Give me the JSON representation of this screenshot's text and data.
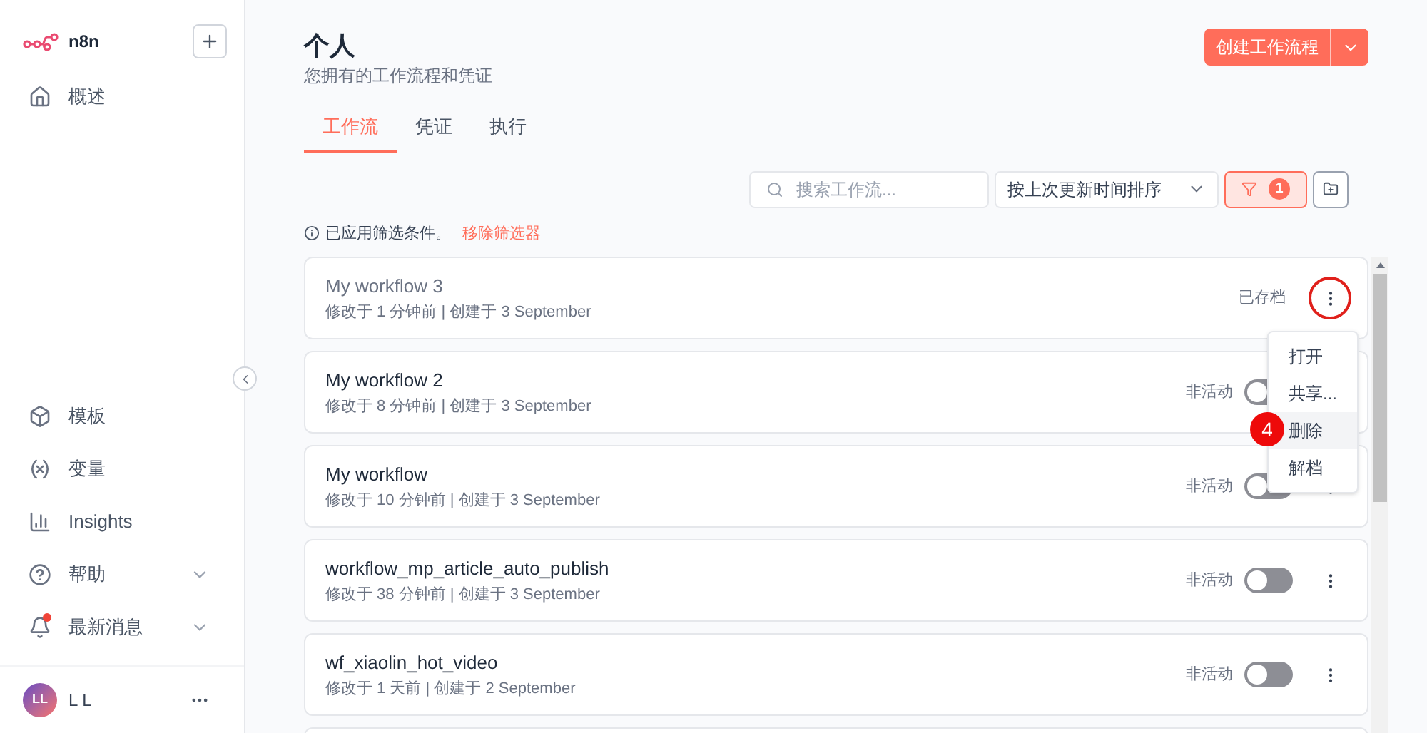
{
  "sidebar": {
    "logo_text": "n8n",
    "top_items": [
      {
        "label": "概述"
      }
    ],
    "bottom_items": [
      {
        "label": "模板",
        "expandable": false,
        "dot": false
      },
      {
        "label": "变量",
        "expandable": false,
        "dot": false
      },
      {
        "label": "Insights",
        "expandable": false,
        "dot": false
      },
      {
        "label": "帮助",
        "expandable": true,
        "dot": false
      },
      {
        "label": "最新消息",
        "expandable": true,
        "dot": true
      }
    ],
    "user": {
      "initials": "LL",
      "name": "L L"
    }
  },
  "header": {
    "title": "个人",
    "subtitle": "您拥有的工作流程和凭证",
    "create_button": "创建工作流程"
  },
  "tabs": [
    {
      "label": "工作流",
      "selected": true
    },
    {
      "label": "凭证",
      "selected": false
    },
    {
      "label": "执行",
      "selected": false
    }
  ],
  "toolbar": {
    "search": {
      "placeholder": "搜索工作流..."
    },
    "sort": {
      "value": "按上次更新时间排序"
    },
    "filter_count": "1"
  },
  "filter_notice": {
    "text": "已应用筛选条件。",
    "link": "移除筛选器"
  },
  "workflows": [
    {
      "name": "My workflow 3",
      "meta": "修改于 1 分钟前 | 创建于 3 September",
      "archived": true,
      "status": "已存档",
      "highlighted": true
    },
    {
      "name": "My workflow 2",
      "meta": "修改于 8 分钟前 | 创建于 3 September",
      "archived": false,
      "status": "非活动",
      "on": false,
      "highlighted": false
    },
    {
      "name": "My workflow",
      "meta": "修改于 10 分钟前 | 创建于 3 September",
      "archived": false,
      "status": "非活动",
      "on": false,
      "highlighted": false
    },
    {
      "name": "workflow_mp_article_auto_publish",
      "meta": "修改于 38 分钟前 | 创建于 3 September",
      "archived": false,
      "status": "非活动",
      "on": false,
      "highlighted": false
    },
    {
      "name": "wf_xiaolin_hot_video",
      "meta": "修改于 1 天前 | 创建于 2 September",
      "archived": false,
      "status": "非活动",
      "on": false,
      "highlighted": false
    }
  ],
  "context_menu": {
    "step_badge": "4",
    "items": [
      {
        "label": "打开",
        "selected": false
      },
      {
        "label": "共享...",
        "selected": false
      },
      {
        "label": "删除",
        "selected": true
      },
      {
        "label": "解档",
        "selected": false
      }
    ]
  }
}
